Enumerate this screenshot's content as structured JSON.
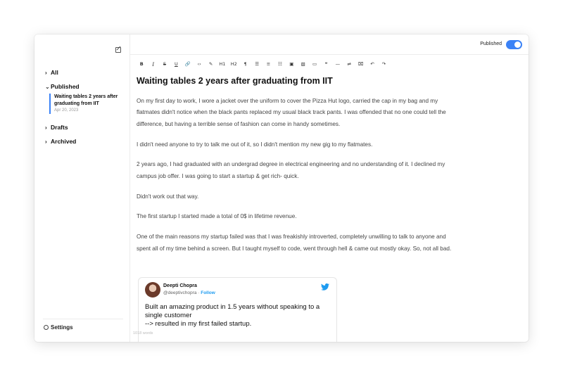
{
  "sidebar": {
    "nav": {
      "all": "All",
      "published": "Published",
      "drafts": "Drafts",
      "archived": "Archived"
    },
    "published_post": {
      "title": "Waiting tables 2 years after graduating from IIT",
      "date": "Apr 20, 2023"
    },
    "settings_label": "Settings"
  },
  "topbar": {
    "published_label": "Published",
    "published_on": true
  },
  "toolbar": {
    "buttons": [
      {
        "name": "bold-button",
        "label": "B"
      },
      {
        "name": "italic-button",
        "label": "I"
      },
      {
        "name": "strike-button",
        "label": "S"
      },
      {
        "name": "underline-button",
        "label": "U"
      },
      {
        "name": "link-button",
        "label": "🔗"
      },
      {
        "name": "code-button",
        "label": "‹›"
      },
      {
        "name": "highlight-button",
        "label": "✎"
      },
      {
        "name": "h1-button",
        "label": "H1"
      },
      {
        "name": "h2-button",
        "label": "H2"
      },
      {
        "name": "paragraph-button",
        "label": "¶"
      },
      {
        "name": "bullet-list-button",
        "label": "☰"
      },
      {
        "name": "ordered-list-button",
        "label": "≡"
      },
      {
        "name": "task-list-button",
        "label": "☷"
      },
      {
        "name": "image-button",
        "label": "▣"
      },
      {
        "name": "gallery-button",
        "label": "▧"
      },
      {
        "name": "embed-button",
        "label": "▭"
      },
      {
        "name": "quote-button",
        "label": "❝"
      },
      {
        "name": "divider-button",
        "label": "—"
      },
      {
        "name": "align-button",
        "label": "⇌"
      },
      {
        "name": "clear-format-button",
        "label": "⌧"
      },
      {
        "name": "undo-button",
        "label": "↶"
      },
      {
        "name": "redo-button",
        "label": "↷"
      }
    ]
  },
  "document": {
    "title": "Waiting tables 2 years after graduating from IIT",
    "paragraphs": [
      "On my first day to work, I wore a jacket over the uniform to cover the Pizza Hut logo, carried the cap in my bag and my flatmates didn't notice when the black pants replaced my usual black track pants. I was offended that no one could tell the difference, but having a terrible sense of fashion can come in handy sometimes.",
      "I didn't need anyone to try to talk me out of it, so I didn't mention my new gig to my flatmates.",
      "2 years ago, I had graduated with an undergrad degree in electrical engineering and no understanding of it. I declined my campus job offer. I was going to start a startup & get rich- quick.",
      "Didn't work out that way.",
      "The first startup I started made a total of 0$ in lifetime revenue.",
      "One of the main reasons my startup failed was that I was freakishly introverted, completely unwilling to talk to anyone and spent all of my time behind a screen. But I taught myself to code, went through hell & came out mostly okay. So, not all bad."
    ],
    "word_count": "1018 words"
  },
  "tweet": {
    "name": "Deepti Chopra",
    "handle": "@deeptivchopra",
    "separator": " · ",
    "follow": "Follow",
    "lines": [
      "Built an amazing product in 1.5 years without speaking to a",
      "single customer",
      "--> resulted in my first failed startup."
    ]
  },
  "colors": {
    "accent": "#3b82f6",
    "twitter": "#1d9bf0"
  }
}
